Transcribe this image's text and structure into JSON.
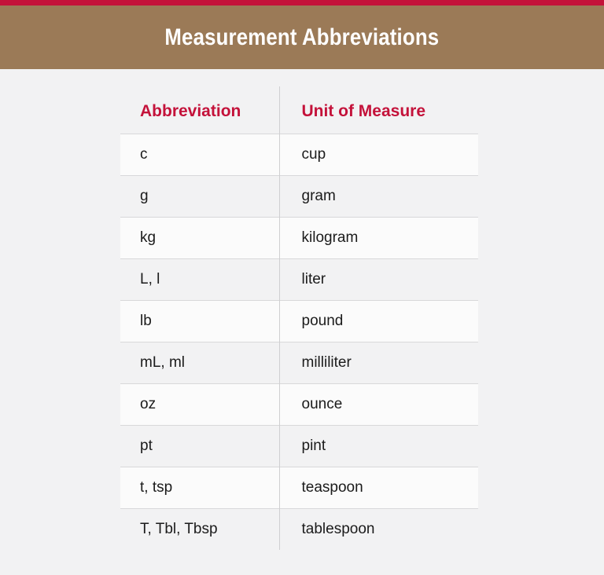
{
  "header": {
    "accent_color": "#c4123a",
    "banner_color": "#9b7a57",
    "title": "Measurement Abbreviations"
  },
  "table": {
    "columns": [
      {
        "label": "Abbreviation"
      },
      {
        "label": "Unit of Measure"
      }
    ],
    "rows": [
      {
        "abbreviation": "c",
        "unit": "cup"
      },
      {
        "abbreviation": "g",
        "unit": "gram"
      },
      {
        "abbreviation": "kg",
        "unit": "kilogram"
      },
      {
        "abbreviation": "L, l",
        "unit": "liter"
      },
      {
        "abbreviation": "lb",
        "unit": "pound"
      },
      {
        "abbreviation": "mL, ml",
        "unit": "milliliter"
      },
      {
        "abbreviation": "oz",
        "unit": "ounce"
      },
      {
        "abbreviation": "pt",
        "unit": "pint"
      },
      {
        "abbreviation": "t, tsp",
        "unit": "teaspoon"
      },
      {
        "abbreviation": "T, Tbl, Tbsp",
        "unit": "tablespoon"
      }
    ]
  },
  "theme": {
    "page_background": "#f2f2f3",
    "row_light": "#fbfbfb",
    "row_shaded": "#f2f2f3",
    "heading_color": "#c4123a",
    "text_color": "#1b1b1b",
    "border_color": "#d8d8da"
  }
}
